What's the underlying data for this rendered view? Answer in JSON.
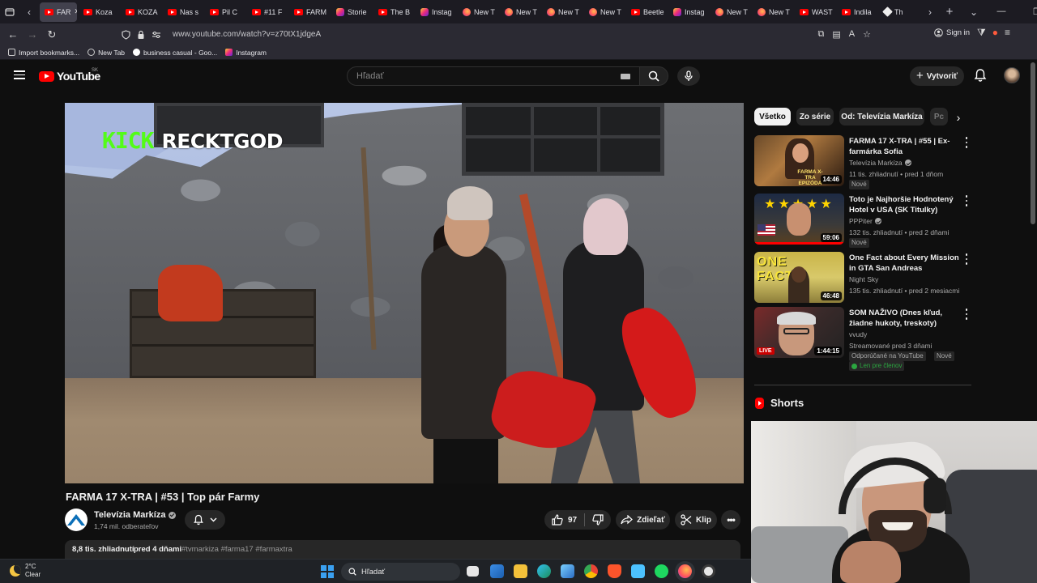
{
  "browser": {
    "tabs": [
      {
        "label": "FAR",
        "favicon": "youtube",
        "active": true
      },
      {
        "label": "Koza",
        "favicon": "youtube"
      },
      {
        "label": "KOZA",
        "favicon": "youtube"
      },
      {
        "label": "Nas s",
        "favicon": "youtube"
      },
      {
        "label": "Pil C",
        "favicon": "youtube"
      },
      {
        "label": "#11 F",
        "favicon": "youtube"
      },
      {
        "label": "FARM",
        "favicon": "youtube"
      },
      {
        "label": "Storie",
        "favicon": "instagram"
      },
      {
        "label": "The B",
        "favicon": "youtube"
      },
      {
        "label": "Instag",
        "favicon": "instagram"
      },
      {
        "label": "New T",
        "favicon": "firefox"
      },
      {
        "label": "New T",
        "favicon": "firefox"
      },
      {
        "label": "New T",
        "favicon": "firefox"
      },
      {
        "label": "New T",
        "favicon": "firefox"
      },
      {
        "label": "Beetle",
        "favicon": "youtube"
      },
      {
        "label": "Instag",
        "favicon": "instagram"
      },
      {
        "label": "New T",
        "favicon": "firefox"
      },
      {
        "label": "New T",
        "favicon": "firefox"
      },
      {
        "label": "WAST",
        "favicon": "youtube"
      },
      {
        "label": "Indila",
        "favicon": "youtube"
      },
      {
        "label": "Th",
        "favicon": "generic"
      }
    ],
    "url": "www.youtube.com/watch?v=z70tX1jdgeA",
    "signin_label": "Sign in",
    "bookmarks": [
      "Import bookmarks...",
      "New Tab",
      "business casual - Goo...",
      "Instagram"
    ]
  },
  "youtube": {
    "logo_text": "YouTube",
    "country_code": "SK",
    "search_placeholder": "Hľadať",
    "create_label": "Vytvoriť",
    "video": {
      "overlay_platform": "KICK",
      "overlay_streamer": "RECKTGOD",
      "title": "FARMA 17 X-TRA | #53 | Top pár Farmy",
      "channel": "Televízia Markíza",
      "subscribers": "1,74 mil. odberateľov",
      "likes": "97",
      "share_label": "Zdieľať",
      "clip_label": "Klip",
      "views": "8,8 tis. zhliadnutí",
      "date": "pred 4 dňami",
      "tags": "#tvmarkiza #farma17 #farmaxtra"
    },
    "chips": [
      "Všetko",
      "Zo série",
      "Od: Televízia Markíza",
      "Pc"
    ],
    "recommendations": [
      {
        "title": "FARMA 17 X-TRA | #55 | Ex-farmárka Sofia",
        "channel": "Televízia Markíza",
        "verified": true,
        "meta": "11 tis. zhliadnutí • pred 1 dňom",
        "duration": "14:46",
        "badge": "Nové"
      },
      {
        "title": "Toto je Najhoršie Hodnotený Hotel v USA (SK Titulky)",
        "channel": "PPPiter",
        "verified": true,
        "meta": "132 tis. zhliadnutí • pred 2 dňami",
        "duration": "59:06",
        "badge": "Nové"
      },
      {
        "title": "One Fact about Every Mission in GTA San Andreas",
        "channel": "Night Sky",
        "verified": false,
        "meta": "135 tis. zhliadnutí • pred 2 mesiacmi",
        "duration": "46:48",
        "badge": ""
      },
      {
        "title": "SOM NAŽIVO (Dnes kľud, žiadne hukoty, treskoty)",
        "channel": "vvudy",
        "verified": false,
        "meta": "Streamované pred 3 dňami",
        "duration": "1:44:15",
        "badge": "Odporúčané na YouTube",
        "badge2": "Nové",
        "members": "Len pre členov",
        "live": "LIVE"
      }
    ],
    "thumb_texts": {
      "farma": "FARMA X-TRA EPIZÓDA",
      "gta": "ONE FACT"
    },
    "shorts_label": "Shorts"
  },
  "taskbar": {
    "temperature": "2°C",
    "condition": "Clear",
    "search_label": "Hľadať"
  }
}
